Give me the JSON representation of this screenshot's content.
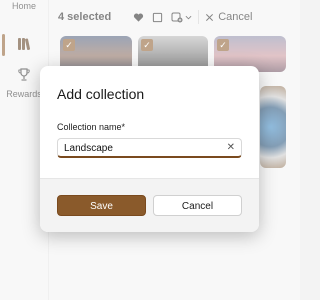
{
  "nav": {
    "home_label": "Home",
    "collections_icon": "library-books-icon",
    "rewards_label": "Rewards",
    "rewards_icon": "trophy-icon",
    "accent": "#8a5a2b"
  },
  "toolbar": {
    "selected_text": "4 selected",
    "heart_icon": "heart-icon",
    "select_all_icon": "checkbox-icon",
    "collection_icon": "add-to-collection-icon",
    "chevron_icon": "chevron-down-icon",
    "close_icon": "close-icon",
    "cancel_label": "Cancel"
  },
  "dialog": {
    "title": "Add collection",
    "field_label": "Collection name*",
    "field_value": "Landscape",
    "clear_icon": "clear-icon",
    "save_label": "Save",
    "cancel_label": "Cancel",
    "accent": "#8a5a2b"
  }
}
